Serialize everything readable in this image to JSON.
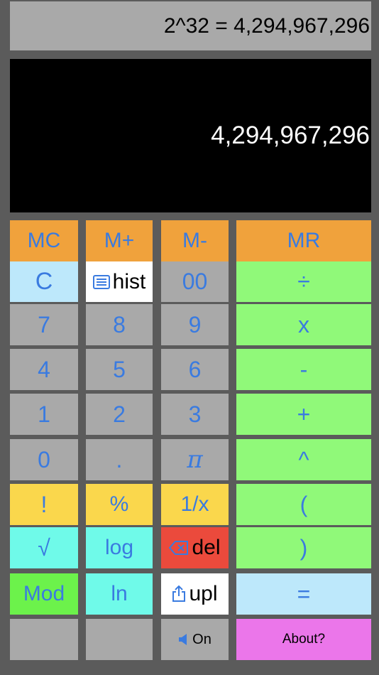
{
  "display": {
    "expression": "2^32 = 4,294,967,296",
    "result": "4,294,967,296"
  },
  "memory": {
    "mc": "MC",
    "mplus": "M+",
    "mminus": "M-",
    "mr": "MR"
  },
  "keys": {
    "clear": "C",
    "hist": "hist",
    "double_zero": "00",
    "divide": "÷",
    "seven": "7",
    "eight": "8",
    "nine": "9",
    "multiply": "x",
    "four": "4",
    "five": "5",
    "six": "6",
    "minus": "-",
    "one": "1",
    "two": "2",
    "three": "3",
    "plus": "+",
    "zero": "0",
    "decimal": ".",
    "pi": "π",
    "power": "^",
    "factorial": "!",
    "percent": "%",
    "reciprocal": "1/x",
    "open_paren": "(",
    "sqrt": "√",
    "log": "log",
    "del": "del",
    "close_paren": ")",
    "mod": "Mod",
    "ln": "ln",
    "upl": "upl",
    "equals": "=",
    "sound": "On",
    "about": "About?"
  },
  "icons": {
    "hist": "list-icon",
    "del": "backspace-icon",
    "upl": "share-icon",
    "sound": "speaker-icon"
  },
  "colors": {
    "memory": "#f0a23c",
    "number": "#a9a9a9",
    "operator": "#90f979",
    "function_yellow": "#fad74c",
    "function_cyan": "#6ffae9",
    "clear": "#bde8fb",
    "delete": "#eb4a3c",
    "mod": "#6cf24b",
    "about": "#eb76ea",
    "key_text": "#3a7be0"
  }
}
